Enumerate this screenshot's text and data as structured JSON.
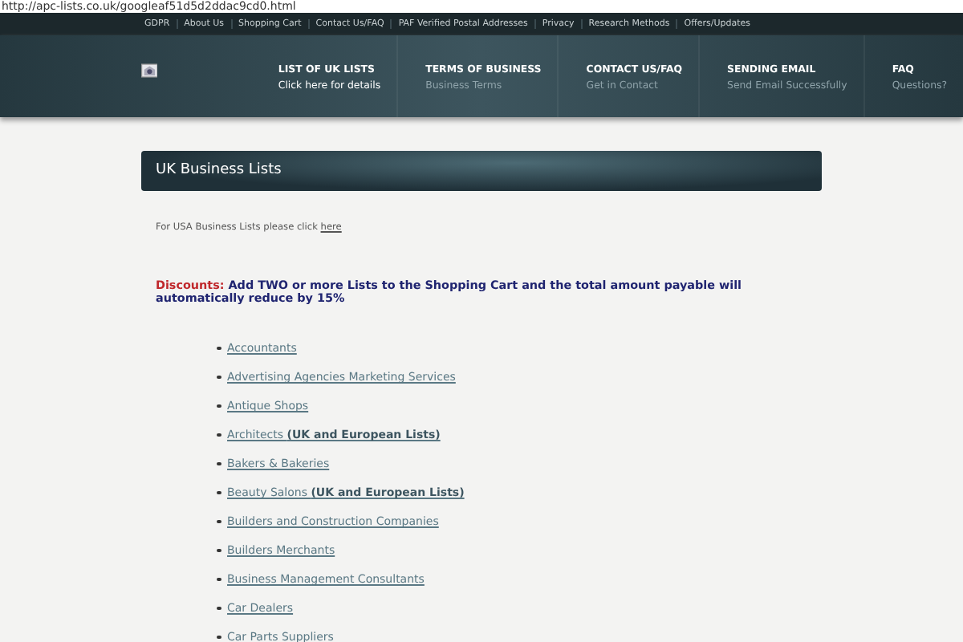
{
  "address_bar": {
    "url": "http://apc-lists.co.uk/googleaf51d5d2ddac9cd0.html"
  },
  "top_links": [
    "GDPR",
    "About Us",
    "Shopping Cart",
    "Contact Us/FAQ",
    "PAF Verified Postal Addresses",
    "Privacy",
    "Research Methods",
    "Offers/Updates"
  ],
  "nav": [
    {
      "title": "LIST OF UK LISTS",
      "subtitle": "Click here for details",
      "selected": true
    },
    {
      "title": "TERMS OF BUSINESS",
      "subtitle": "Business Terms",
      "selected": false
    },
    {
      "title": "CONTACT US/FAQ",
      "subtitle": "Get in Contact",
      "selected": false
    },
    {
      "title": "SENDING EMAIL",
      "subtitle": "Send Email Successfully",
      "selected": false
    },
    {
      "title": "FAQ",
      "subtitle": "Questions?",
      "selected": false
    }
  ],
  "page_title": "UK Business Lists",
  "usa_note": {
    "text": "For USA Business Lists please click",
    "link": "here"
  },
  "discount": {
    "label": "Discounts:",
    "text": "Add TWO or more Lists to the Shopping Cart and the total amount payable will automatically reduce by 15%"
  },
  "categories": [
    "Accountants",
    "Advertising Agencies Marketing Services",
    "Antique Shops",
    "Architects **(UK and European Lists)**",
    "Bakers & Bakeries",
    "Beauty Salons **(UK and European Lists)**",
    "Builders and Construction Companies",
    "Builders Merchants",
    "Business Management Consultants",
    "Car Dealers",
    "Car Parts Suppliers"
  ]
}
